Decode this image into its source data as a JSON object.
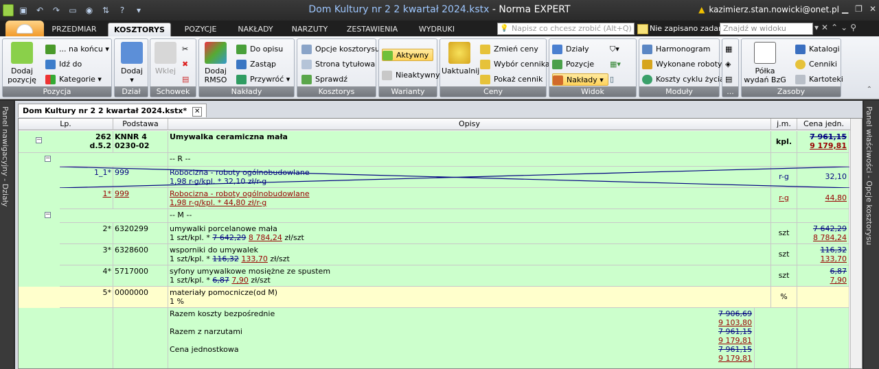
{
  "window": {
    "title_doc": "Dom Kultury nr 2 2 kwartał 2024.kstx",
    "title_sep": " - ",
    "title_app": "Norma EXPERT",
    "user": "kazimierz.stan.nowicki@onet.pl"
  },
  "tabs": [
    "PRZEDMIAR",
    "KOSZTORYS",
    "POZYCJE",
    "NAKŁADY",
    "NARZUTY",
    "ZESTAWIENIA",
    "WYDRUKI"
  ],
  "active_tab": "KOSZTORYS",
  "hint_placeholder": "Napisz co chcesz zrobić (Alt+Q)",
  "unsaved": "Nie zapisano zadań",
  "find_placeholder": "Znajdź w widoku",
  "ribbon": {
    "pozycja": {
      "label": "Pozycja",
      "add": "Dodaj pozycję",
      "end": "... na końcu",
      "goto": "Idź do",
      "categories": "Kategorie"
    },
    "dzial": {
      "label": "Dział",
      "add": "Dodaj"
    },
    "schowek": {
      "label": "Schowek",
      "paste": "Wklej"
    },
    "naklady": {
      "label": "Nakłady",
      "rmso": "Dodaj RMSO",
      "toplan": "Do opisu",
      "replace": "Zastąp",
      "convert": "Przywróć"
    },
    "kosztorys": {
      "label": "Kosztorys",
      "options": "Opcje kosztorysu",
      "titlepage": "Strona tytułowa",
      "check": "Sprawdź"
    },
    "warianty": {
      "label": "Warianty",
      "active": "Aktywny",
      "inactive": "Nieaktywny"
    },
    "ceny": {
      "label": "Ceny",
      "update": "Uaktualnij",
      "change": "Zmień ceny",
      "choose": "Wybór cennika",
      "show": "Pokaż cennik"
    },
    "widok": {
      "label": "Widok",
      "sections": "Działy",
      "positions": "Pozycje",
      "naklady": "Nakłady"
    },
    "moduly": {
      "label": "Moduły",
      "schedule": "Harmonogram",
      "done": "Wykonane roboty",
      "lifecycle": "Koszty cyklu życia"
    },
    "zasoby": {
      "label": "Zasoby",
      "shelf": "Półka wydań BzG",
      "catalogs": "Katalogi",
      "pricelists": "Cenniki",
      "cards": "Kartoteki"
    }
  },
  "left_panel": "Panel nawigacyjny - Działy",
  "right_panel": "Panel właściwości - Opcje kosztorysu",
  "doc_tab": "Dom Kultury nr 2 2 kwartał 2024.kstx*",
  "columns": {
    "lp": "Lp.",
    "podstawa": "Podstawa",
    "opisy": "Opisy",
    "jm": "j.m.",
    "cena": "Cena jedn."
  },
  "position": {
    "lp": "262",
    "lp2": "d.5.2",
    "podstawa1": "KNNR 4",
    "podstawa2": "0230-02",
    "opis": "Umywalka ceramiczna mała",
    "jm": "kpl.",
    "cena_old": "7 961,15",
    "cena_new": "9 179,81"
  },
  "r_header": "-- R --",
  "m_header": "-- M --",
  "r1": {
    "lp": "1_1*",
    "kod": "999",
    "opis": "Robocizna - roboty ogólnobudowlane",
    "norm": "1,98 r-g/kpl. * 32,10 zł/r-g",
    "jm": "r-g",
    "cena": "32,10"
  },
  "r2": {
    "lp": "1*",
    "kod": "999",
    "opis": "Robocizna - roboty ogólnobudowlane",
    "norm": "1,98 r-g/kpl. * 44,80 zł/r-g",
    "jm": "r-g",
    "cena": "44,80"
  },
  "m1": {
    "lp": "2*",
    "kod": "6320299",
    "opis": "umywalki porcelanowe mała",
    "norm_pre": "1 szt/kpl. *",
    "old": "7 642,29",
    "new": "8 784,24",
    "unit": "zł/szt",
    "jm": "szt"
  },
  "m2": {
    "lp": "3*",
    "kod": "6328600",
    "opis": "wsporniki do umywalek",
    "norm_pre": "1 szt/kpl. *",
    "old": "116,32",
    "new": "133,70",
    "unit": "zł/szt",
    "jm": "szt"
  },
  "m3": {
    "lp": "4*",
    "kod": "5717000",
    "opis": "syfony umywalkowe mosiężne ze spustem",
    "norm_pre": "1 szt/kpl. *",
    "old": "6,87",
    "new": "7,90",
    "unit": "zł/szt",
    "jm": "szt"
  },
  "m4": {
    "lp": "5*",
    "kod": "0000000",
    "opis": "materiały pomocnicze(od M)",
    "norm": "1 %",
    "jm": "%"
  },
  "summary": {
    "direct": "Razem koszty bezpośrednie",
    "direct_old": "7 906,69",
    "direct_new": "9 103,80",
    "overhead": "Razem z narzutami",
    "overhead_old": "7 961,15",
    "overhead_new": "9 179,81",
    "unit": "Cena jednostkowa",
    "unit_old": "7 961,15",
    "unit_new": "9 179,81"
  }
}
